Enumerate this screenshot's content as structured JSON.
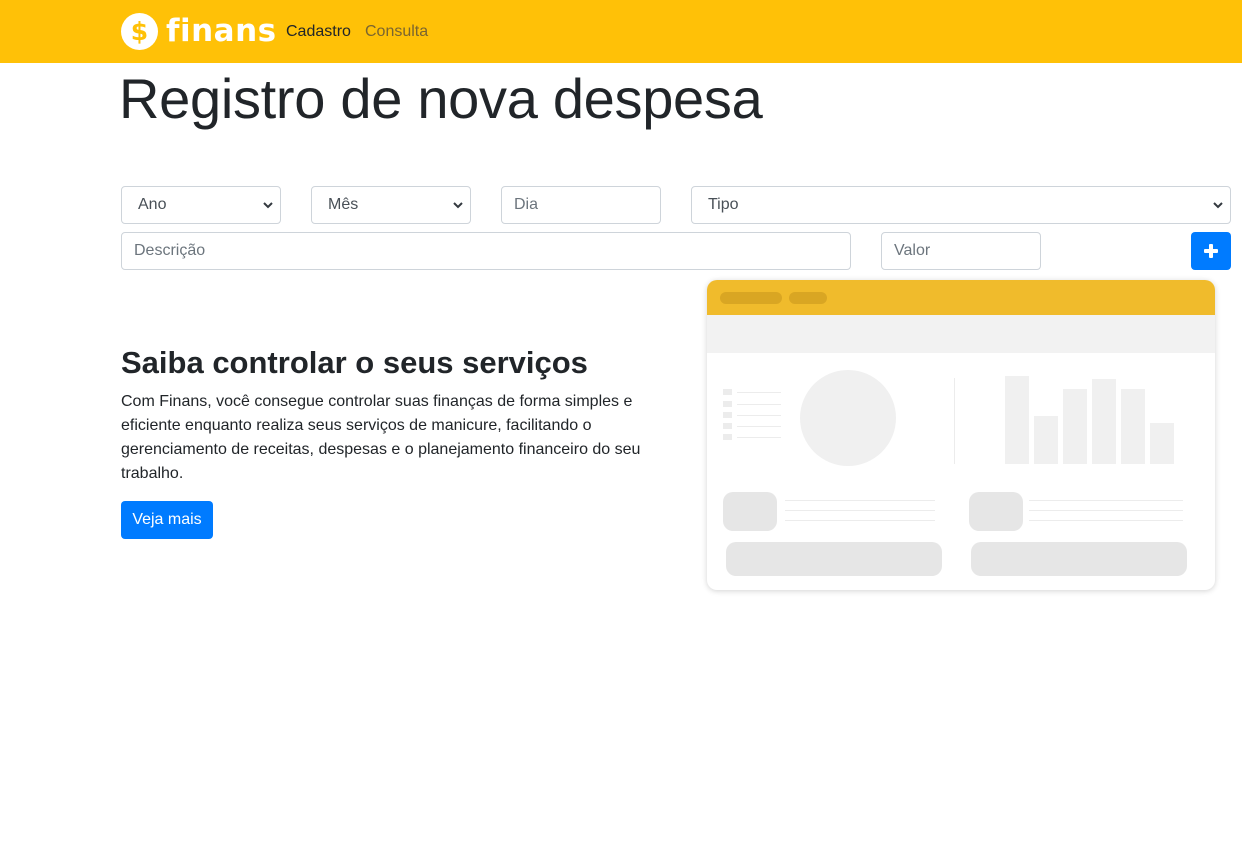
{
  "navbar": {
    "brand_symbol": "$",
    "brand_name": "finans",
    "links": [
      {
        "label": "Cadastro",
        "active": true
      },
      {
        "label": "Consulta",
        "active": false
      }
    ],
    "background_color": "#ffc107"
  },
  "page": {
    "title": "Registro de nova despesa"
  },
  "form": {
    "ano": {
      "selected": "Ano"
    },
    "mes": {
      "selected": "Mês"
    },
    "dia": {
      "placeholder": "Dia"
    },
    "tipo": {
      "selected": "Tipo"
    },
    "descricao": {
      "placeholder": "Descrição"
    },
    "valor": {
      "placeholder": "Valor"
    },
    "add_button_icon": "plus-icon"
  },
  "promo": {
    "title": "Saiba controlar o seus serviços",
    "text": "Com Finans, você consegue controlar suas finanças de forma simples e eficiente enquanto realiza seus serviços de manicure, facilitando o gerenciamento de receitas, despesas e o planejamento financeiro do seu trabalho.",
    "button_label": "Veja mais",
    "button_color": "#007bff"
  },
  "illustration": {
    "header_color": "#f0bb2c",
    "bar_levels": [
      1.0,
      0.55,
      0.85,
      0.97,
      0.85,
      0.47
    ]
  }
}
